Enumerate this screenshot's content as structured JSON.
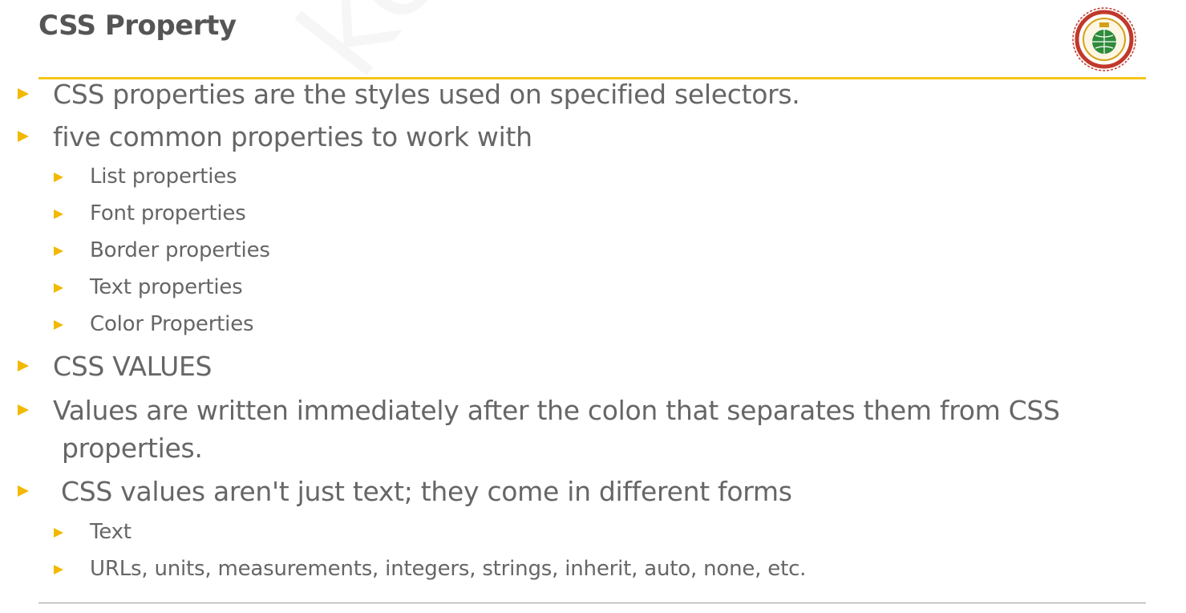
{
  "slide": {
    "title": "CSS Property",
    "watermark": "keralanotes",
    "accent_color": "#f5c518",
    "logo_icon": "college-seal-icon"
  },
  "bullets": [
    {
      "text": "CSS properties are the styles used on specified selectors."
    },
    {
      "text": "five common properties to work with"
    },
    {
      "text": "List properties"
    },
    {
      "text": "Font properties"
    },
    {
      "text": "Border properties"
    },
    {
      "text": "Text properties"
    },
    {
      "text": "Color Properties"
    },
    {
      "text": "CSS VALUES"
    },
    {
      "text": "Values are written immediately after the colon that separates them from CSS",
      "continuation": "properties."
    },
    {
      "text": "CSS values aren't just text; they come in different forms"
    },
    {
      "text": "Text"
    },
    {
      "text": "URLs, units, measurements, integers, strings, inherit, auto, none, etc."
    }
  ]
}
